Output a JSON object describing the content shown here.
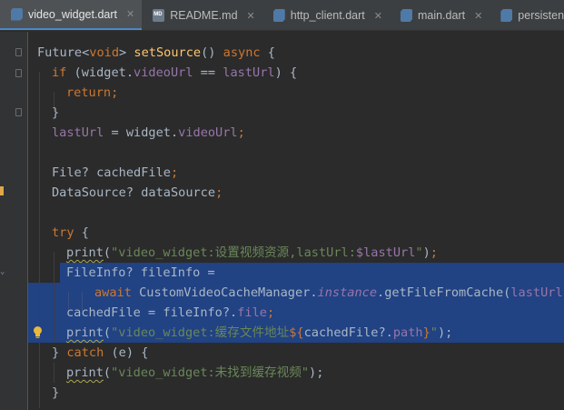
{
  "tabs": [
    {
      "name": "video_widget.dart",
      "active": true,
      "icon": "dart-file-icon"
    },
    {
      "name": "README.md",
      "active": false,
      "icon": "markdown-file-icon"
    },
    {
      "name": "http_client.dart",
      "active": false,
      "icon": "dart-file-icon"
    },
    {
      "name": "main.dart",
      "active": false,
      "icon": "dart-file-icon"
    },
    {
      "name": "persistent_cache",
      "active": false,
      "icon": "dart-file-icon"
    }
  ],
  "close_glyph": "✕",
  "code": {
    "l1": {
      "a": "Future<",
      "b": "void",
      "c": "> ",
      "d": "setSource",
      "e": "() ",
      "f": "async",
      " g": " {"
    },
    "l2": {
      "a": "if",
      " b": " (widget.",
      "c": "videoUrl",
      "d": " == ",
      "e": "lastUrl",
      "f": ") {"
    },
    "l3": {
      "a": "return",
      "b": ";"
    },
    "l4": {
      "a": "}"
    },
    "l5": {
      "a": "lastUrl",
      "b": " = widget.",
      "c": "videoUrl",
      "d": ";"
    },
    "l7": {
      "a": "File? cachedFile",
      "b": ";"
    },
    "l8": {
      "a": "DataSource? dataSource",
      "b": ";"
    },
    "l10": {
      "a": "try",
      " b": " {"
    },
    "l11": {
      "a": "print",
      "b": "(",
      "c": "\"video_widget:设置视频资源,lastUrl:",
      "d": "$lastUrl",
      "e": "\"",
      "f": ")",
      "g": ";"
    },
    "l12": {
      "a": "FileInfo? fileInfo ="
    },
    "l13": {
      "a": "await",
      " b": " CustomVideoCacheManager.",
      "c": "instance",
      "d": ".getFileFromCache(",
      "e": "lastUrl",
      "f": ");"
    },
    "l14": {
      "a": "cachedFile = fileInfo?.",
      "b": "file",
      "c": ";"
    },
    "l15": {
      "a": "print",
      "b": "(",
      "c": "\"video_widget:缓存文件地址",
      "d": "${",
      "e": "cachedFile?.",
      "f": "path",
      "g": "}",
      "h": "\"",
      "i": ");"
    },
    "l16": {
      "a": "} ",
      "b": "catch",
      " c": " (e) {"
    },
    "l17": {
      "a": "print",
      "b": "(",
      "c": "\"video_widget:未找到缓存视频\"",
      "d": ");"
    },
    "l18": {
      "a": "}"
    }
  },
  "colors": {
    "editor_bg": "#2b2b2b",
    "selection": "#214283",
    "keyword": "#cc7832",
    "function": "#ffc66d",
    "field": "#9876aa",
    "string": "#6a8759",
    "text": "#a9b7c6"
  }
}
